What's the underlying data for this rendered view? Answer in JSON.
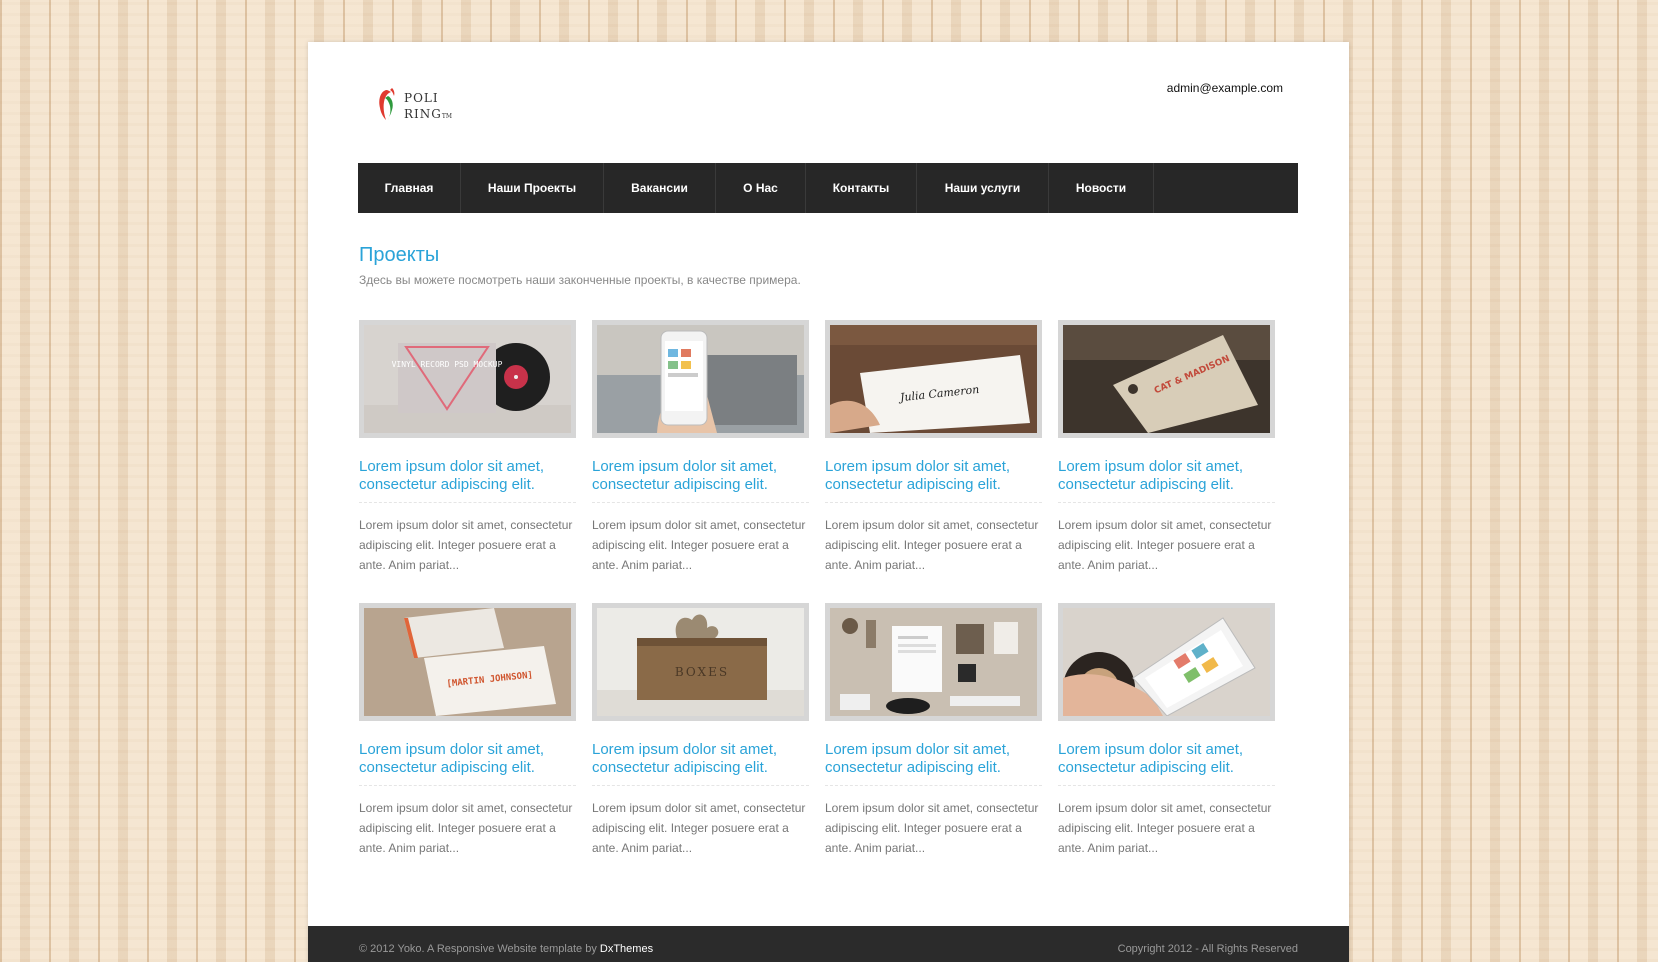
{
  "header": {
    "logo_line1": "POLI",
    "logo_line2": "RING",
    "logo_tm": "TM",
    "email": "admin@example.com"
  },
  "nav": [
    {
      "label": "Главная"
    },
    {
      "label": "Наши Проекты"
    },
    {
      "label": "Вакансии"
    },
    {
      "label": "О Нас"
    },
    {
      "label": "Контакты"
    },
    {
      "label": "Наши услуги"
    },
    {
      "label": "Новости"
    }
  ],
  "main": {
    "title": "Проекты",
    "subtitle": "Здесь вы можете посмотреть наши законченные проекты, в качестве примера."
  },
  "cards": [
    {
      "title": "Lorem ipsum dolor sit amet, consectetur adipiscing elit.",
      "text": "Lorem ipsum dolor sit amet, consectetur adipiscing elit. Integer posuere erat a ante. Anim pariat...",
      "image_text": "VINYL RECORD PSD MOCKUP"
    },
    {
      "title": "Lorem ipsum dolor sit amet, consectetur adipiscing elit.",
      "text": "Lorem ipsum dolor sit amet, consectetur adipiscing elit. Integer posuere erat a ante. Anim pariat..."
    },
    {
      "title": "Lorem ipsum dolor sit amet, consectetur adipiscing elit.",
      "text": "Lorem ipsum dolor sit amet, consectetur adipiscing elit. Integer posuere erat a ante. Anim pariat...",
      "image_text": "Julia Cameron"
    },
    {
      "title": "Lorem ipsum dolor sit amet, consectetur adipiscing elit.",
      "text": "Lorem ipsum dolor sit amet, consectetur adipiscing elit. Integer posuere erat a ante. Anim pariat...",
      "image_text": "CAT & MADISON"
    },
    {
      "title": "Lorem ipsum dolor sit amet, consectetur adipiscing elit.",
      "text": "Lorem ipsum dolor sit amet, consectetur adipiscing elit. Integer posuere erat a ante. Anim pariat...",
      "image_text": "[MARTIN JOHNSON]"
    },
    {
      "title": "Lorem ipsum dolor sit amet, consectetur adipiscing elit.",
      "text": "Lorem ipsum dolor sit amet, consectetur adipiscing elit. Integer posuere erat a ante. Anim pariat...",
      "image_text": "BOXES"
    },
    {
      "title": "Lorem ipsum dolor sit amet, consectetur adipiscing elit.",
      "text": "Lorem ipsum dolor sit amet, consectetur adipiscing elit. Integer posuere erat a ante. Anim pariat..."
    },
    {
      "title": "Lorem ipsum dolor sit amet, consectetur adipiscing elit.",
      "text": "Lorem ipsum dolor sit amet, consectetur adipiscing elit. Integer posuere erat a ante. Anim pariat..."
    }
  ],
  "footer": {
    "left_text": "© 2012 Yoko.  A Responsive Website template by ",
    "left_link": "DxThemes",
    "right_text": "Copyright 2012 - All Rights Reserved"
  },
  "colors": {
    "accent": "#2aa3d8",
    "nav_bg": "#272727",
    "footer_bg": "#2b2b2b",
    "logo_red": "#e03a2f",
    "logo_green": "#2f9a3d"
  }
}
